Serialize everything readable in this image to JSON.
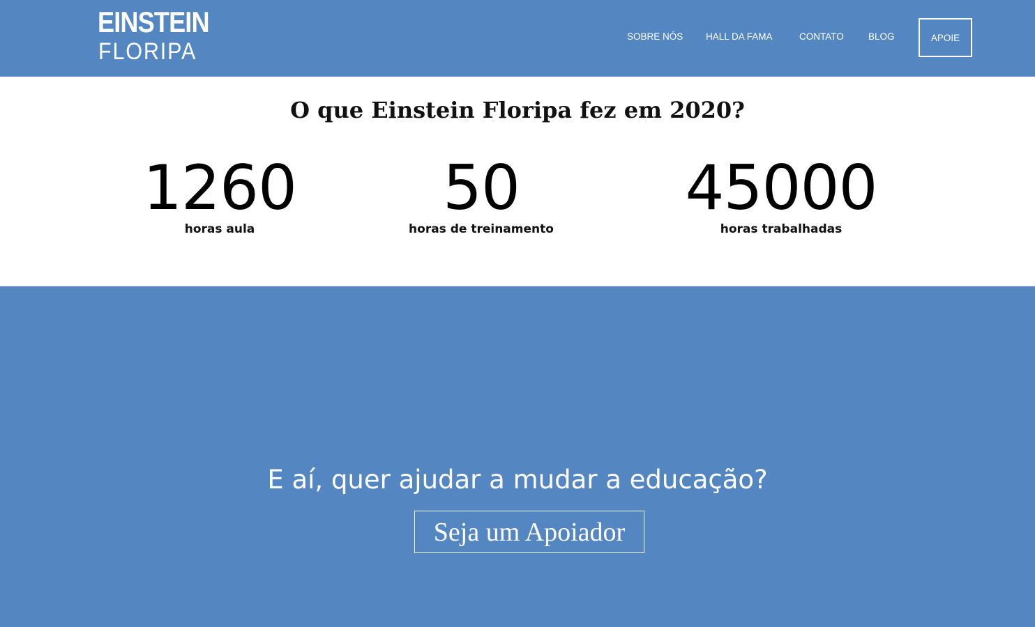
{
  "header": {
    "logo": {
      "line1": "EINSTEIN",
      "line2": "FLORIPA"
    },
    "nav": [
      {
        "label": "SOBRE NÓS"
      },
      {
        "label": "HALL DA FAMA"
      },
      {
        "label": "CONTATO"
      },
      {
        "label": "BLOG"
      }
    ],
    "cta_label": "APOIE"
  },
  "stats": {
    "title": "O que Einstein Floripa fez em 2020?",
    "items": [
      {
        "value": "1260",
        "label": "horas aula"
      },
      {
        "value": "50",
        "label": "horas de treinamento"
      },
      {
        "value": "45000",
        "label": "horas trabalhadas"
      }
    ]
  },
  "cta": {
    "text": "E aí, quer ajudar a mudar a educação?",
    "button_label": "Seja um Apoiador"
  },
  "colors": {
    "brand_blue": "#5487c2",
    "text_dark": "#111111",
    "white": "#ffffff"
  }
}
